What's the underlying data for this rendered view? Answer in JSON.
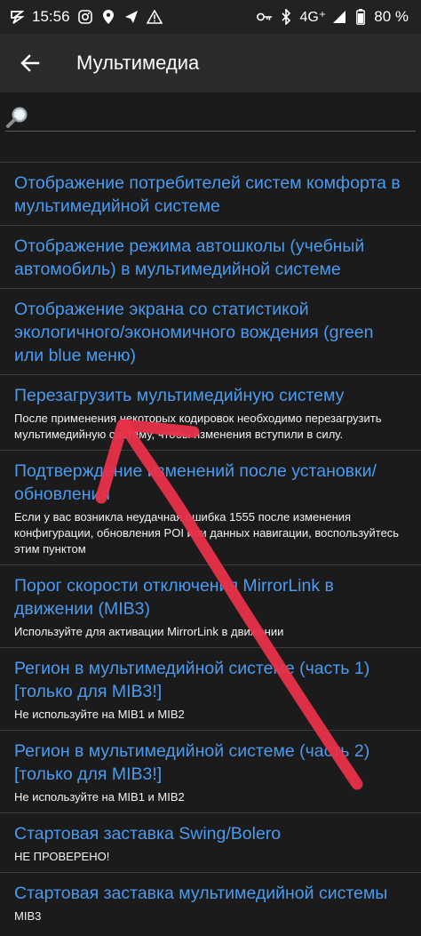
{
  "status_bar": {
    "time": "15:56",
    "network": "4G⁺",
    "battery": "80 %",
    "left_icons": [
      "notification-s-icon",
      "instagram-icon",
      "location-icon",
      "send-icon",
      "warning-icon"
    ],
    "right_icons": [
      "key-icon",
      "bluetooth-icon",
      "signal-icon",
      "battery-icon"
    ]
  },
  "app_bar": {
    "title": "Мультимедиа",
    "back_icon": "arrow-left-icon"
  },
  "search": {
    "placeholder": "",
    "value": "",
    "icon": "magnifier-icon"
  },
  "items": [
    {
      "title": "Отображение потребителей систем комфорта в мультимедийной системе",
      "subtitle": ""
    },
    {
      "title": "Отображение режима автошколы (учебный автомобиль) в мультимедийной системе",
      "subtitle": ""
    },
    {
      "title": "Отображение экрана со статистикой экологичного/экономичного вождения (green или blue меню)",
      "subtitle": ""
    },
    {
      "title": "Перезагрузить мультимедийную систему",
      "subtitle": "После применения некоторых кодировок необходимо перезагрузить мультимедийную систему, чтобы изменения вступили в силу."
    },
    {
      "title": "Подтверждение изменений после установки/обновления",
      "subtitle": "Если у вас возникла неудачная ошибка 1555 после изменения конфигурации, обновления POI или данных навигации, воспользуйтесь этим пунктом"
    },
    {
      "title": "Порог скорости отключения MirrorLink в движении (MIB3)",
      "subtitle": "Используйте для активации MirrorLink в движении"
    },
    {
      "title": "Регион в мультимедийной системе (часть 1) [только для MIB3!]",
      "subtitle": "Не используйте на MIB1 и MIB2"
    },
    {
      "title": "Регион в мультимедийной системе (часть 2) [только для MIB3!]",
      "subtitle": "Не используйте на MIB1 и MIB2"
    },
    {
      "title": "Стартовая заставка Swing/Bolero",
      "subtitle": "НЕ ПРОВЕРЕНО!"
    },
    {
      "title": "Стартовая заставка мультимедийной системы",
      "subtitle": "MIB3"
    }
  ],
  "colors": {
    "background": "#1b1b1b",
    "app_bar": "#2b2b2b",
    "link": "#4a9bf0",
    "annotation_arrow": "#e8324a"
  }
}
